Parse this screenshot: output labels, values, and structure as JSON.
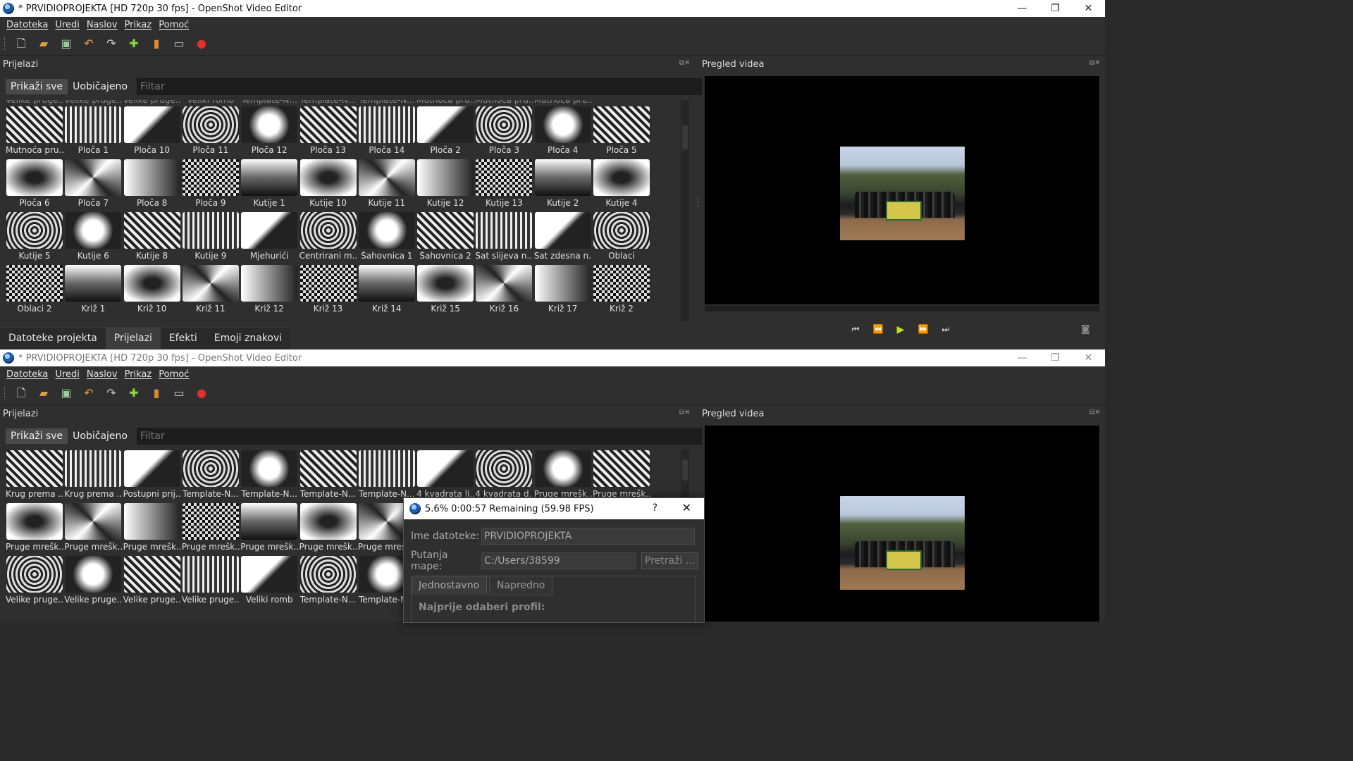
{
  "window1": {
    "title": "* PRVIDIOPROJEKTA [HD 720p 30 fps] - OpenShot Video Editor",
    "controls": {
      "minimize": "—",
      "restore": "❐",
      "close": "✕"
    },
    "menu": [
      "Datoteka",
      "Uredi",
      "Naslov",
      "Prikaz",
      "Pomoć"
    ],
    "transitions_panel": {
      "title": "Prijelazi",
      "filter_buttons": [
        "Prikaži sve",
        "Uobičajeno"
      ],
      "filter_placeholder": "Filtar",
      "partial_row_labels": [
        "Velike pruge...",
        "Velike pruge...",
        "Velike pruge...",
        "Veliki romb",
        "Template-N...",
        "Template-N...",
        "Template-N...",
        "Mutnoća pru...",
        "Mutnoća pru...",
        "Mutnoća pru..."
      ],
      "items": [
        "Mutnoća pru...",
        "Ploča 1",
        "Ploča 10",
        "Ploča 11",
        "Ploča 12",
        "Ploča 13",
        "Ploča 14",
        "Ploča 2",
        "Ploča 3",
        "Ploča 4",
        "Ploča 5",
        "Ploča 6",
        "Ploča 7",
        "Ploča 8",
        "Ploča 9",
        "Kutije 1",
        "Kutije 10",
        "Kutije 11",
        "Kutije 12",
        "Kutije 13",
        "Kutije 2",
        "Kutije 4",
        "Kutije 5",
        "Kutije 6",
        "Kutije 8",
        "Kutije 9",
        "Mjehurići",
        "Centrirani m...",
        "Šahovnica 1",
        "Šahovnica 2",
        "Sat slijeva n...",
        "Sat zdesna n...",
        "Oblaci",
        "Oblaci 2",
        "Križ 1",
        "Križ 10",
        "Križ 11",
        "Križ 12",
        "Križ 13",
        "Križ 14",
        "Križ 15",
        "Križ 16",
        "Križ 17",
        "Križ 2"
      ]
    },
    "bottom_tabs": [
      "Datoteke projekta",
      "Prijelazi",
      "Efekti",
      "Emoji znakovi"
    ],
    "preview": {
      "title": "Pregled videa"
    },
    "transport": {
      "start": "⏮",
      "rewind": "⏪",
      "play": "▶",
      "forward": "⏩",
      "end": "⏭"
    }
  },
  "window2": {
    "title": "* PRVIDIOPROJEKTA [HD 720p 30 fps] - OpenShot Video Editor",
    "controls": {
      "minimize": "—",
      "restore": "❐",
      "close": "✕"
    },
    "menu": [
      "Datoteka",
      "Uredi",
      "Naslov",
      "Prikaz",
      "Pomoć"
    ],
    "transitions_panel": {
      "title": "Prijelazi",
      "filter_buttons": [
        "Prikaži sve",
        "Uobičajeno"
      ],
      "filter_placeholder": "Filtar",
      "items": [
        "Krug prema ...",
        "Krug prema ...",
        "Postupni prij...",
        "Template-N...",
        "Template-N...",
        "Template-N...",
        "Template-N...",
        "4 kvadrata li...",
        "4 kvadrata d...",
        "Pruge mrešk...",
        "Pruge mrešk...",
        "Pruge mrešk...",
        "Pruge mrešk...",
        "Pruge mrešk...",
        "Pruge mrešk...",
        "Pruge mrešk...",
        "Pruge mrešk...",
        "Pruge mrešk...",
        "",
        "",
        "",
        "",
        "Velike pruge...",
        "Velike pruge...",
        "Velike pruge...",
        "Velike pruge...",
        "Veliki romb",
        "Template-N...",
        "Template-N..."
      ]
    },
    "preview": {
      "title": "Pregled videa"
    }
  },
  "export_dialog": {
    "title": "5.6%  0:00:57 Remaining (59.98 FPS)",
    "help": "?",
    "close": "✕",
    "filename_label": "Ime datoteke:",
    "filename_value": "PRVIDIOPROJEKTA",
    "folder_label": "Putanja mape:",
    "folder_value": "C:/Users/38599",
    "browse_label": "Pretraži ...",
    "tabs": [
      "Jednostavno",
      "Napredno"
    ],
    "section_title": "Najprije odaberi profil:"
  },
  "colors": {
    "window_bg": "#2f2f2f",
    "preview_bg": "#000000",
    "accent_play": "#c6e020"
  }
}
